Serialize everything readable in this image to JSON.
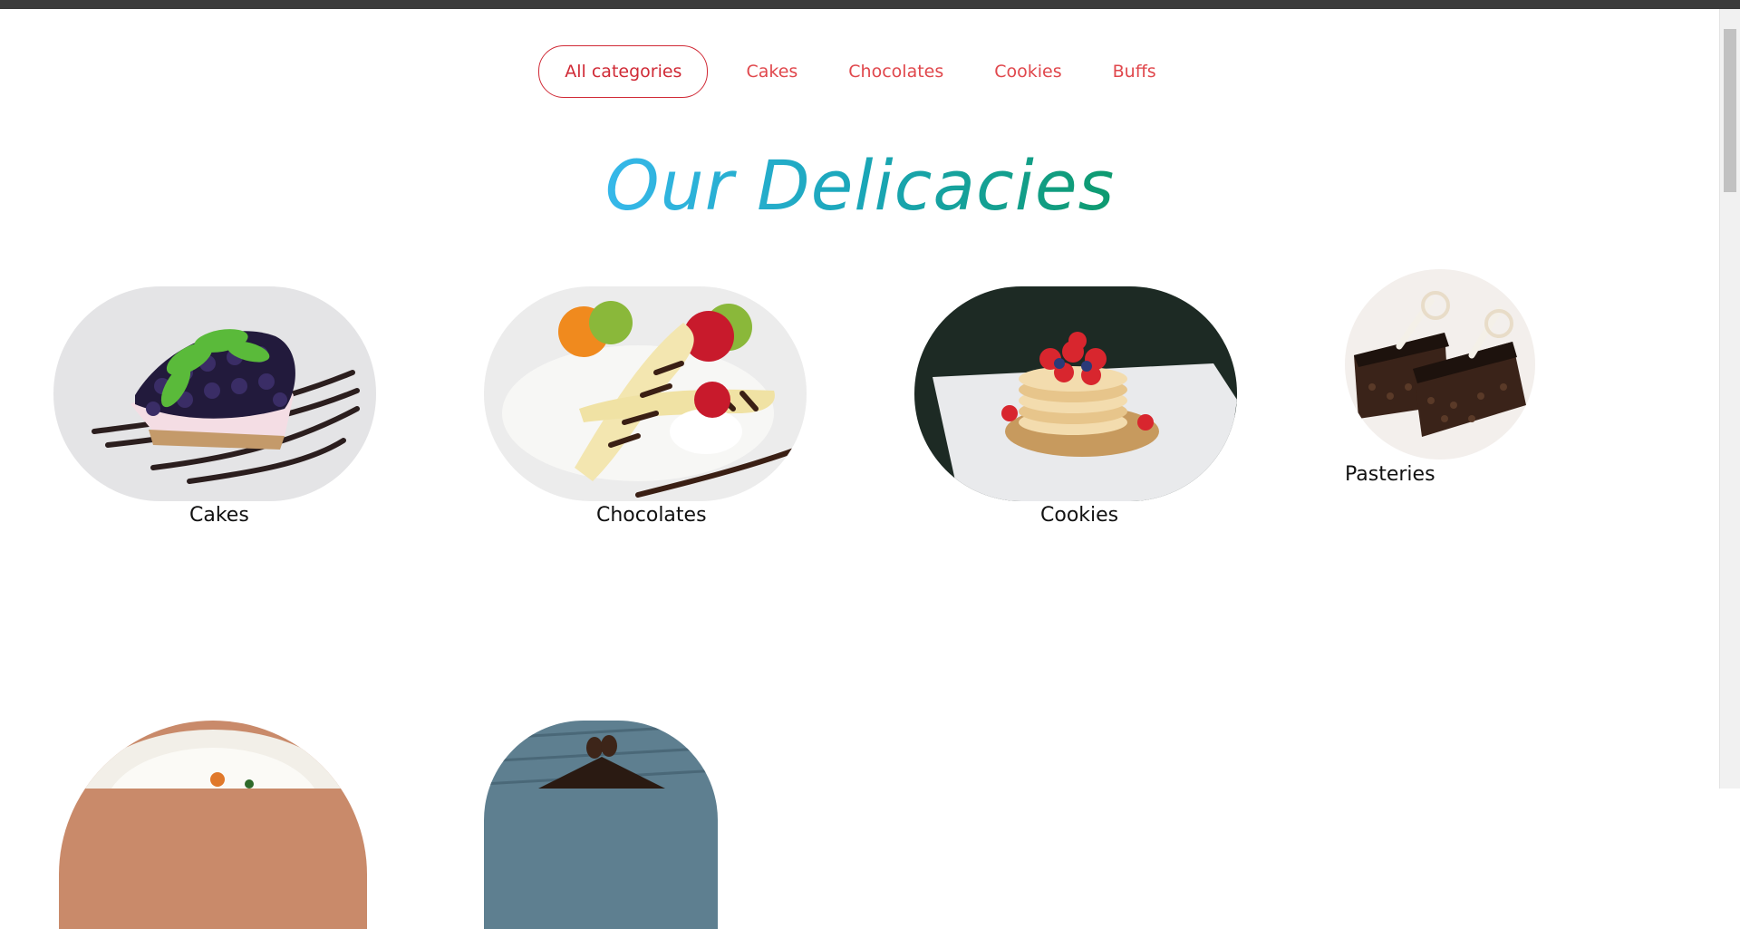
{
  "nav": {
    "tabs": [
      {
        "label": "All categories",
        "active": true
      },
      {
        "label": "Cakes",
        "active": false
      },
      {
        "label": "Chocolates",
        "active": false
      },
      {
        "label": "Cookies",
        "active": false
      },
      {
        "label": "Buffs",
        "active": false
      }
    ]
  },
  "section": {
    "title": "Our Delicacies"
  },
  "items": [
    {
      "label": "Cakes",
      "image": "blueberry-cheesecake-slice"
    },
    {
      "label": "Chocolates",
      "image": "banana-split-chocolate"
    },
    {
      "label": "Cookies",
      "image": "pancake-stack-berries"
    },
    {
      "label": "Pasteries",
      "image": "chocolate-pastry-slices"
    },
    {
      "label": "",
      "image": "food-bowl"
    },
    {
      "label": "",
      "image": "chocolate-cake-slice"
    }
  ],
  "colors": {
    "accent": "#e0474c",
    "active_tab": "#d02a36",
    "heading_gradient_start": "#36b8ea",
    "heading_gradient_end": "#0e9a6e"
  }
}
